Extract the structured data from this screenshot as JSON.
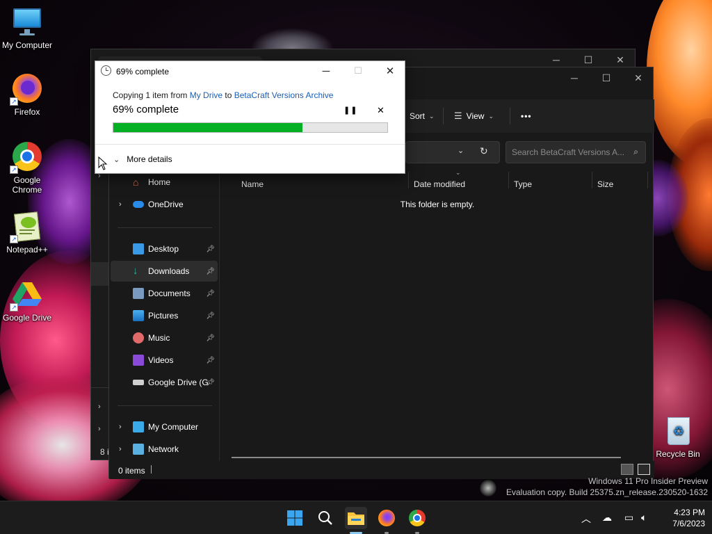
{
  "desktop": {
    "icons": [
      {
        "label": "My Computer"
      },
      {
        "label": "Firefox"
      },
      {
        "label": "Google\nChrome"
      },
      {
        "label": "Notepad++"
      },
      {
        "label": "Google Drive"
      },
      {
        "label": "Recycle Bin"
      }
    ],
    "watermark_line1": "Windows 11 Pro Insider Preview",
    "watermark_line2": "Evaluation copy. Build 25375.zn_release.230520-1632"
  },
  "back_window": {
    "status_prefix": "8 i"
  },
  "explorer": {
    "toolbar": {
      "sort_label": "Sort",
      "view_label": "View",
      "more_label": "•••"
    },
    "search_placeholder": "Search BetaCraft Versions A...",
    "nav": [
      {
        "label": "Home"
      },
      {
        "label": "OneDrive"
      },
      {
        "label": "Desktop"
      },
      {
        "label": "Downloads"
      },
      {
        "label": "Documents"
      },
      {
        "label": "Pictures"
      },
      {
        "label": "Music"
      },
      {
        "label": "Videos"
      },
      {
        "label": "Google Drive (G:"
      },
      {
        "label": "My Computer"
      },
      {
        "label": "Network"
      }
    ],
    "columns": [
      "Name",
      "Date modified",
      "Type",
      "Size"
    ],
    "empty_message": "This folder is empty.",
    "status": "0 items"
  },
  "copy_dialog": {
    "title": "69% complete",
    "text_prefix": "Copying 1 item from ",
    "source": "My Drive",
    "text_mid": " to ",
    "destination": "BetaCraft Versions Archive",
    "status": "69% complete",
    "progress": 0.69,
    "more_details": "More details"
  },
  "taskbar": {
    "time": "4:23 PM",
    "date": "7/6/2023"
  },
  "colors": {
    "progress_fill": "#06b025",
    "link": "#1a5fb4",
    "dark_window": "#191919"
  }
}
